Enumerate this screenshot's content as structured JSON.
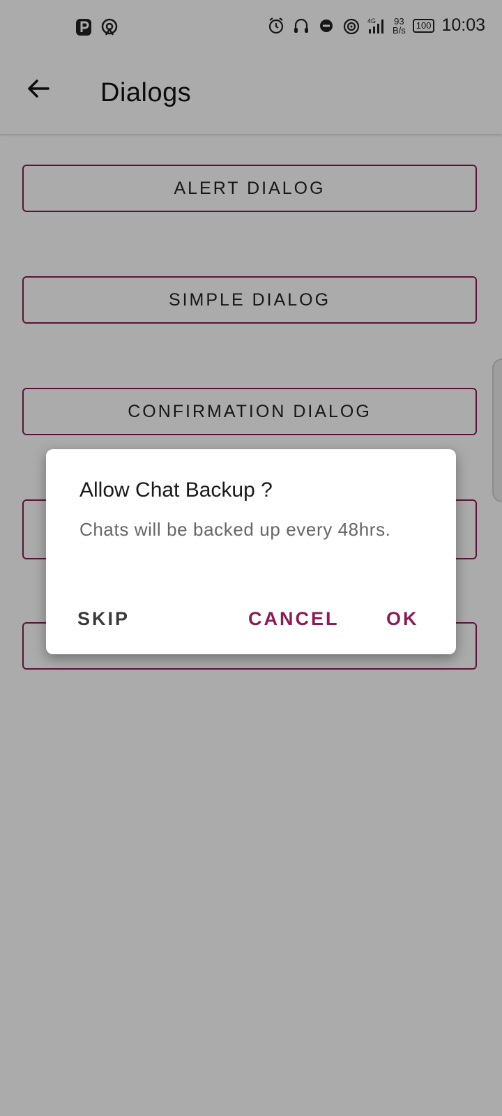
{
  "status_bar": {
    "left_icons": [
      "parking-icon",
      "hotspot-icon"
    ],
    "right_icons": [
      "alarm-icon",
      "headset-icon",
      "dnd-icon",
      "wifi-hotspot-icon",
      "signal-4g-icon"
    ],
    "net_speed_value": "93",
    "net_speed_unit": "B/s",
    "battery": "100",
    "time": "10:03"
  },
  "app_bar": {
    "back_icon": "arrow-back-icon",
    "title": "Dialogs"
  },
  "buttons": [
    {
      "label": "ALERT DIALOG"
    },
    {
      "label": "SIMPLE DIALOG"
    },
    {
      "label": "CONFIRMATION DIALOG"
    },
    {
      "label": ""
    },
    {
      "label": ""
    }
  ],
  "dialog": {
    "title": "Allow Chat Backup ?",
    "message": "Chats will be backed up every 48hrs.",
    "skip_label": "SKIP",
    "cancel_label": "CANCEL",
    "ok_label": "OK"
  },
  "nav_bar": {
    "items": [
      "recents-icon",
      "home-icon",
      "back-icon"
    ]
  },
  "colors": {
    "accent": "#8a1d55",
    "scrim": "#000000"
  }
}
